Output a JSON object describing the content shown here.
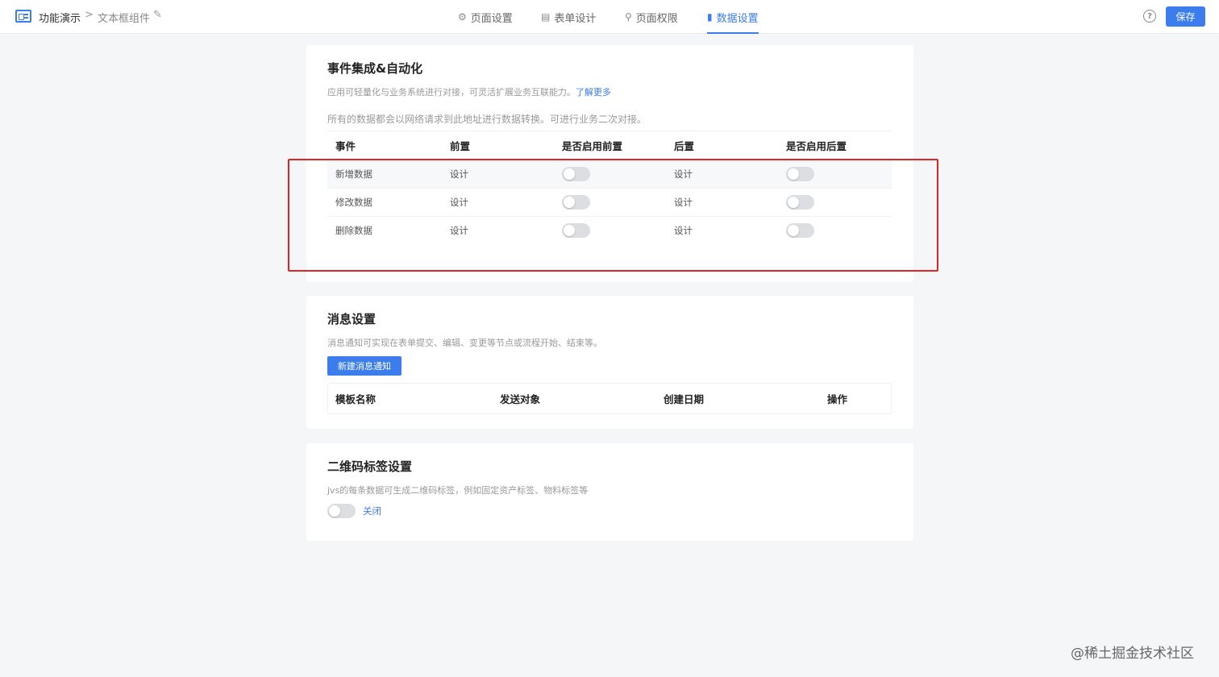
{
  "header": {
    "app_name": "功能演示",
    "separator": ">",
    "page_name": "文本框组件",
    "tabs": [
      {
        "label": "页面设置",
        "icon": "gear-icon",
        "active": false
      },
      {
        "label": "表单设计",
        "icon": "document-icon",
        "active": false
      },
      {
        "label": "页面权限",
        "icon": "lock-icon",
        "active": false
      },
      {
        "label": "数据设置",
        "icon": "bar-chart-icon",
        "active": true
      }
    ],
    "save_label": "保存"
  },
  "events_section": {
    "title": "事件集成&自动化",
    "desc": "应用可轻量化与业务系统进行对接，可灵活扩展业务互联能力。",
    "learn_more": "了解更多",
    "note": "所有的数据都会以网络请求到此地址进行数据转换。可进行业务二次对接。",
    "columns": [
      "事件",
      "前置",
      "是否启用前置",
      "后置",
      "是否启用后置"
    ],
    "rows": [
      {
        "event": "新增数据",
        "pre": "设计",
        "pre_enabled": false,
        "post": "设计",
        "post_enabled": false
      },
      {
        "event": "修改数据",
        "pre": "设计",
        "pre_enabled": false,
        "post": "设计",
        "post_enabled": false
      },
      {
        "event": "删除数据",
        "pre": "设计",
        "pre_enabled": false,
        "post": "设计",
        "post_enabled": false
      }
    ]
  },
  "message_section": {
    "title": "消息设置",
    "desc": "消息通知可实现在表单提交、编辑、变更等节点或流程开始、结束等。",
    "new_button": "新建消息通知",
    "columns": [
      "模板名称",
      "发送对象",
      "创建日期",
      "操作"
    ]
  },
  "qr_section": {
    "title": "二维码标签设置",
    "desc": "jvs的每条数据可生成二维码标签，例如固定资产标签、物料标签等",
    "toggle_enabled": false,
    "toggle_label": "关闭"
  },
  "watermark": "@稀土掘金技术社区",
  "colors": {
    "accent": "#3b7ded",
    "highlight": "#e02424"
  }
}
